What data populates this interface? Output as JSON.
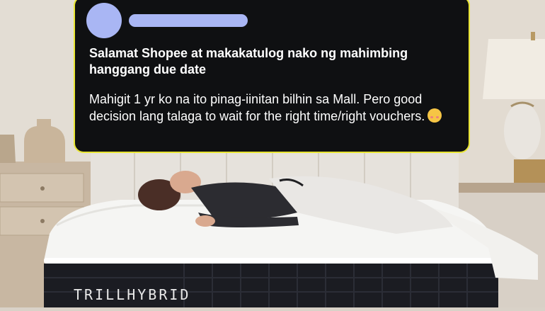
{
  "post": {
    "headline": "Salamat Shopee at makakatulog nako ng mahimbing hanggang due date",
    "body": "Mahigit 1 yr ko na ito pinag-iinitan bilhin sa Mall. Pero good decision lang talaga to wait for the right time/right vouchers."
  },
  "product": {
    "brand": "TRILLHYBRID"
  },
  "colors": {
    "card_bg": "#0f1012",
    "card_border": "#e8e533",
    "avatar_placeholder": "#a9b6f4"
  }
}
